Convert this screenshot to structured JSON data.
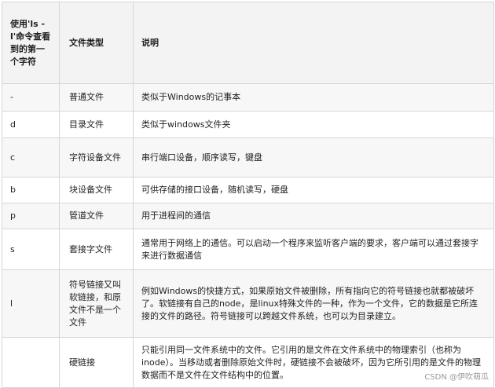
{
  "table": {
    "headers": [
      "使用'ls -l'命令查看到的第一个字符",
      "文件类型",
      "说明"
    ],
    "rows": [
      {
        "char": "-",
        "type": "普通文件",
        "desc": "类似于Windows的记事本"
      },
      {
        "char": "d",
        "type": "目录文件",
        "desc": "类似于windows文件夹"
      },
      {
        "char": "c",
        "type": "字符设备文件",
        "desc": "串行端口设备，顺序读写，键盘"
      },
      {
        "char": "b",
        "type": "块设备文件",
        "desc": "可供存储的接口设备，随机读写，硬盘"
      },
      {
        "char": "p",
        "type": "管道文件",
        "desc": "用于进程间的通信"
      },
      {
        "char": "s",
        "type": "套接字文件",
        "desc": "通常用于网络上的通信。可以启动一个程序来监听客户端的要求，客户端可以通过套接字来进行数据通信"
      },
      {
        "char": "l",
        "type": "符号链接又叫软链接，和原文件不是一个文件",
        "desc": "例如Windows的快捷方式，如果原始文件被删除，所有指向它的符号链接也就都被破坏了。软链接有自己的node，是linux特殊文件的一种，作为一个文件，它的数据是它所连接的文件的路径。符号链接可以跨越文件系统，也可以为目录建立。"
      },
      {
        "char": "",
        "type": "硬链接",
        "desc": "只能引用同一文件系统中的文件。它引用的是文件在文件系统中的物理索引（也称为inode）。当移动或者删除原始文件时，硬链接不会被破坏，因为它所引用的是文件的物理数据而不是文件在文件结构中的位置。"
      }
    ]
  },
  "watermark": "CSDN @伊吹萌瓜"
}
